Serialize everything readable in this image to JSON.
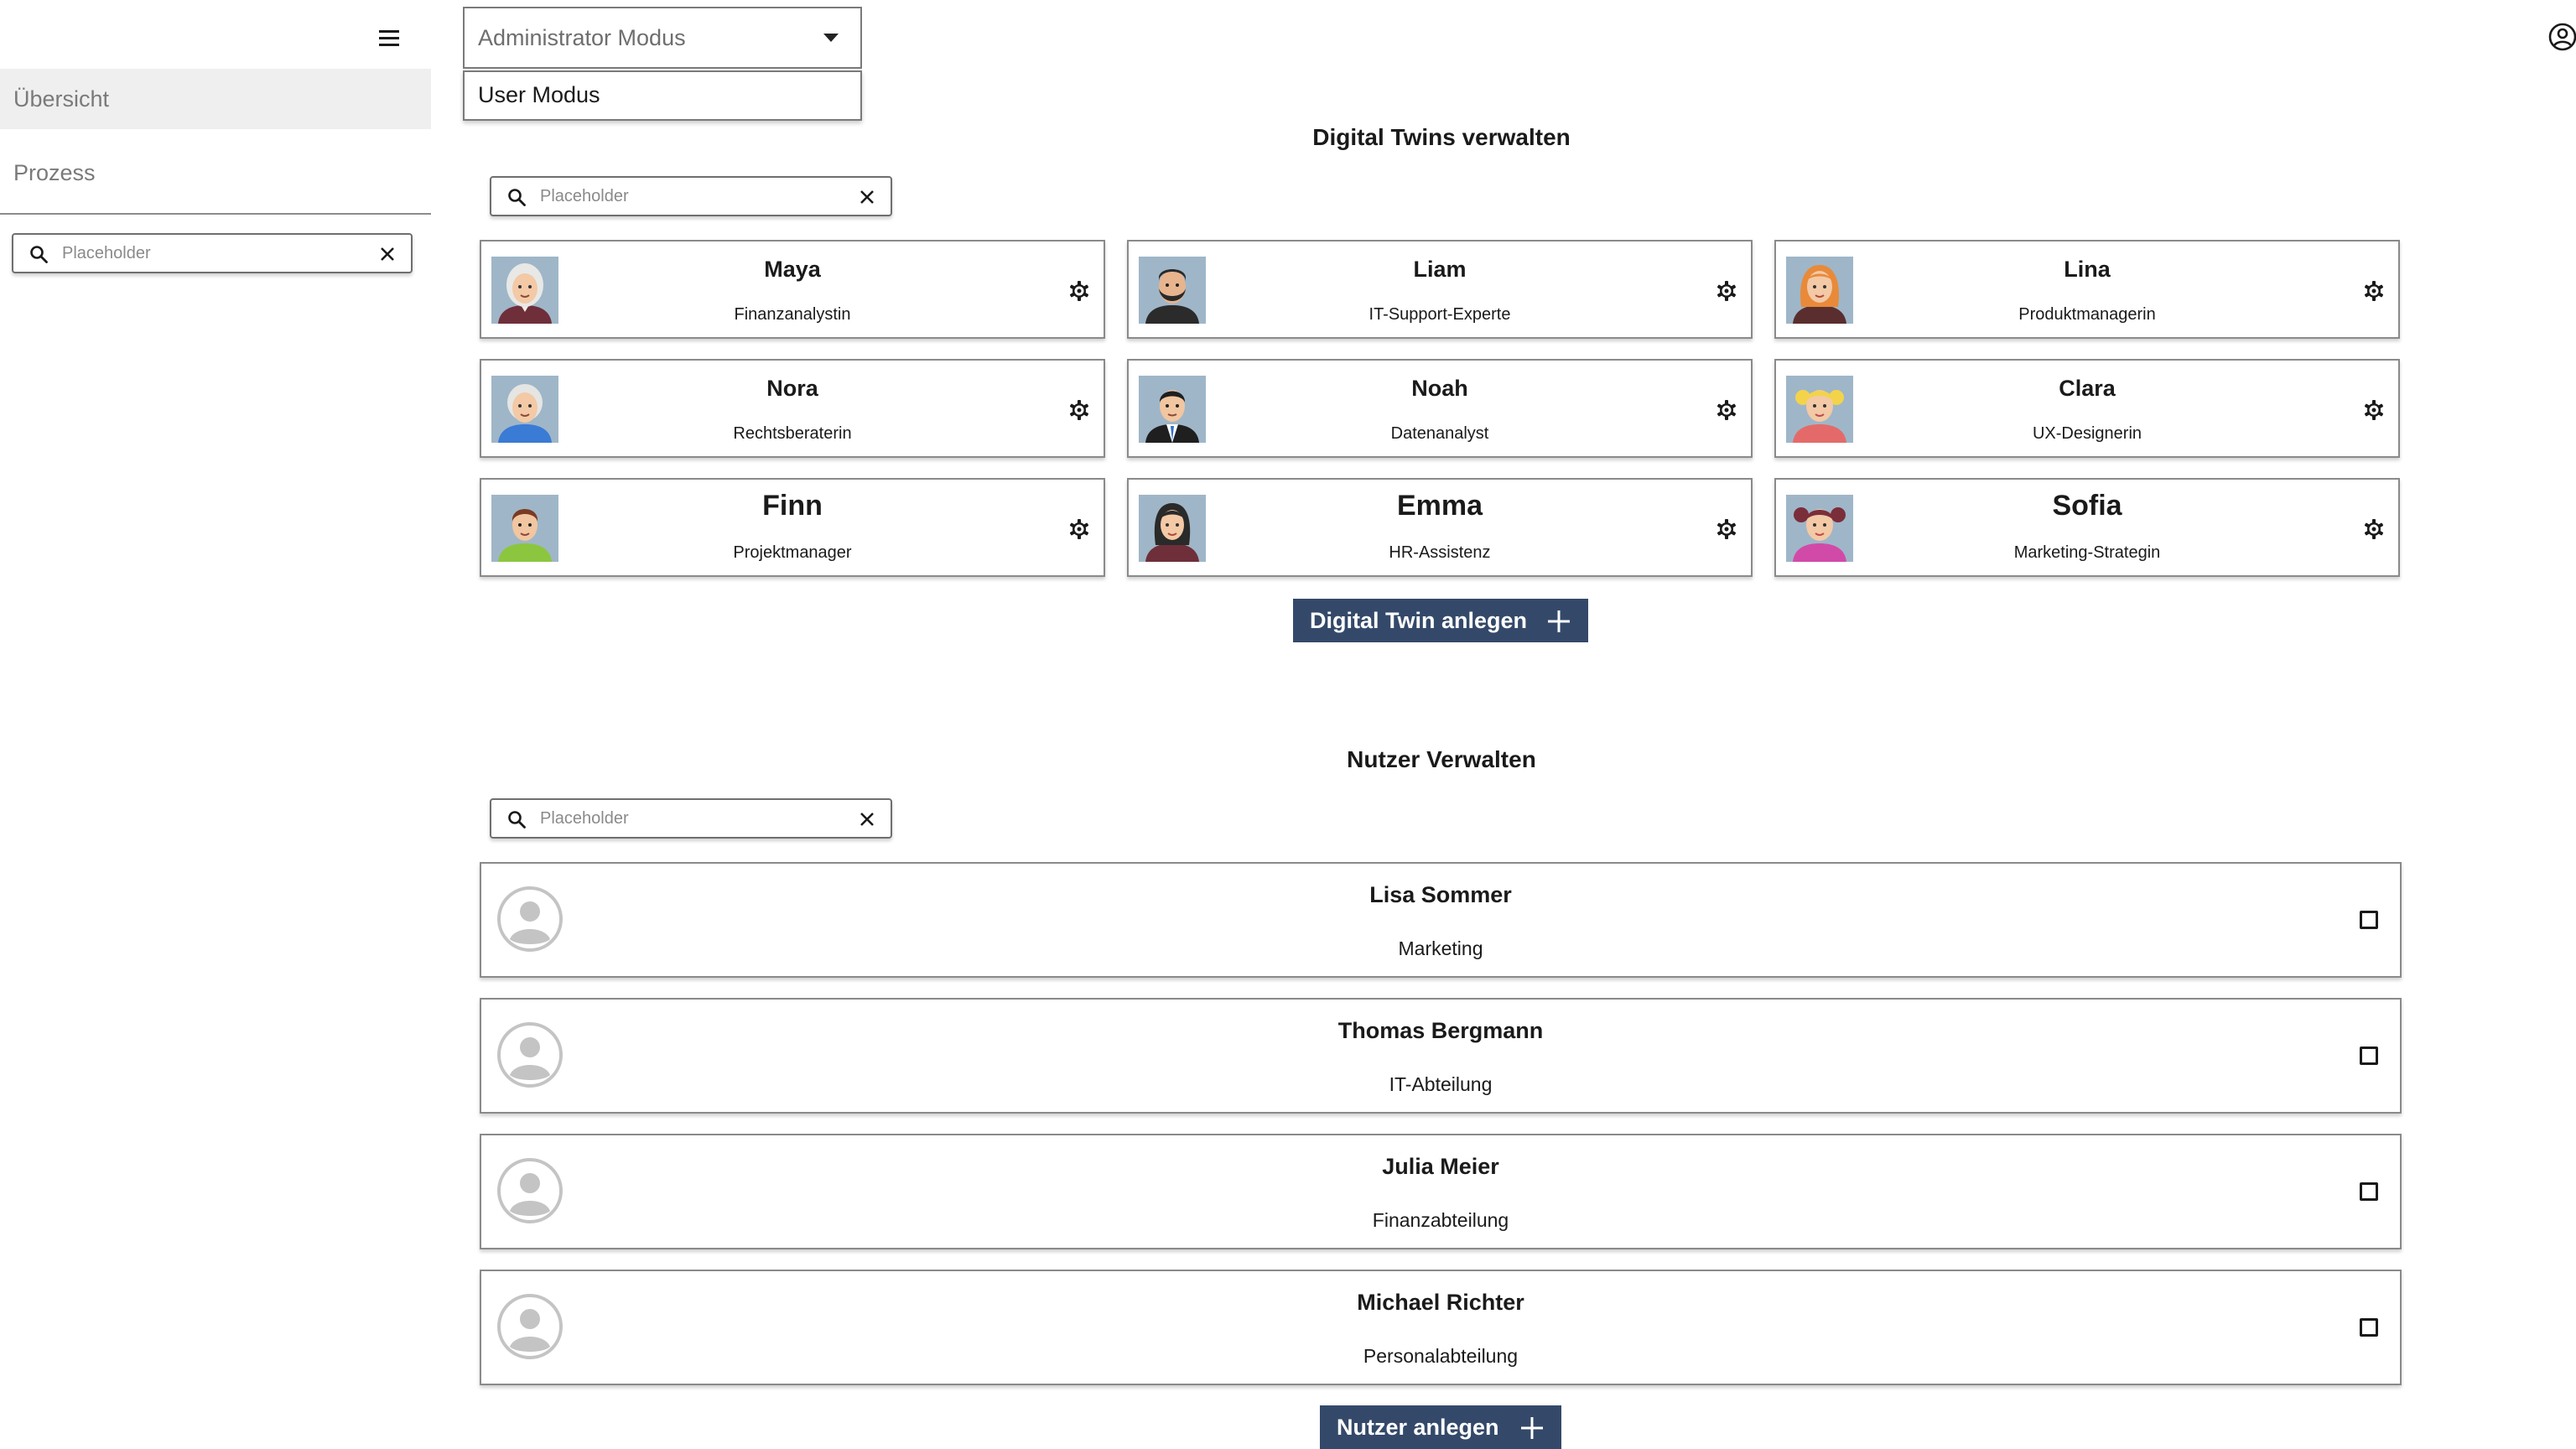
{
  "sidebar": {
    "menu_icon": "hamburger-icon",
    "items": [
      {
        "label": "Übersicht",
        "active": true
      },
      {
        "label": "Prozess",
        "active": false
      }
    ],
    "search": {
      "placeholder": "Placeholder",
      "value": ""
    }
  },
  "header": {
    "mode_select": {
      "value": "Administrator Modus",
      "options": [
        "User Modus"
      ]
    },
    "account_icon": "account-circle-icon"
  },
  "twins_section": {
    "title": "Digital Twins verwalten",
    "search": {
      "placeholder": "Placeholder",
      "value": ""
    },
    "cards": [
      {
        "name": "Maya",
        "role": "Finanzanalystin",
        "avatar": "elderly-woman-avatar"
      },
      {
        "name": "Liam",
        "role": "IT-Support-Experte",
        "avatar": "bearded-man-avatar"
      },
      {
        "name": "Lina",
        "role": "Produktmanagerin",
        "avatar": "red-haired-woman-avatar"
      },
      {
        "name": "Nora",
        "role": "Rechtsberaterin",
        "avatar": "grey-haired-woman-avatar"
      },
      {
        "name": "Noah",
        "role": "Datenanalyst",
        "avatar": "man-in-suit-avatar"
      },
      {
        "name": "Clara",
        "role": "UX-Designerin",
        "avatar": "blonde-girl-avatar"
      },
      {
        "name": "Finn",
        "role": "Projektmanager",
        "avatar": "young-man-avatar"
      },
      {
        "name": "Emma",
        "role": "HR-Assistenz",
        "avatar": "dark-haired-woman-avatar"
      },
      {
        "name": "Sofia",
        "role": "Marketing-Strategin",
        "avatar": "pigtails-girl-avatar"
      }
    ],
    "add_button": "Digital Twin anlegen"
  },
  "users_section": {
    "title": "Nutzer Verwalten",
    "search": {
      "placeholder": "Placeholder",
      "value": ""
    },
    "users": [
      {
        "name": "Lisa Sommer",
        "department": "Marketing",
        "checked": false
      },
      {
        "name": "Thomas Bergmann",
        "department": "IT-Abteilung",
        "checked": false
      },
      {
        "name": "Julia Meier",
        "department": "Finanzabteilung",
        "checked": false
      },
      {
        "name": "Michael Richter",
        "department": "Personalabteilung",
        "checked": false
      }
    ],
    "add_button": "Nutzer anlegen"
  },
  "colors": {
    "primary_button": "#34496a",
    "active_nav_bg": "#efefef"
  }
}
